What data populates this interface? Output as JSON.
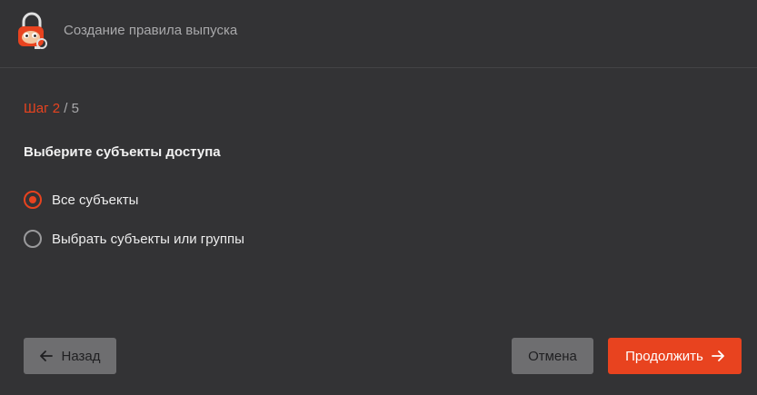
{
  "header": {
    "title": "Создание правила выпуска"
  },
  "wizard": {
    "step_current": "Шаг 2",
    "step_total": " / 5",
    "question": "Выберите субъекты доступа"
  },
  "options": [
    {
      "label": "Все субъекты",
      "selected": true
    },
    {
      "label": "Выбрать субъекты или группы",
      "selected": false
    }
  ],
  "footer": {
    "back_label": "Назад",
    "cancel_label": "Отмена",
    "next_label": "Продолжить"
  },
  "colors": {
    "accent": "#e8431f",
    "background": "#333335",
    "secondary_button": "#6e6e70"
  },
  "icons": {
    "logo": "lock-mascot-logo",
    "back": "arrow-left-icon",
    "next": "arrow-right-icon"
  }
}
